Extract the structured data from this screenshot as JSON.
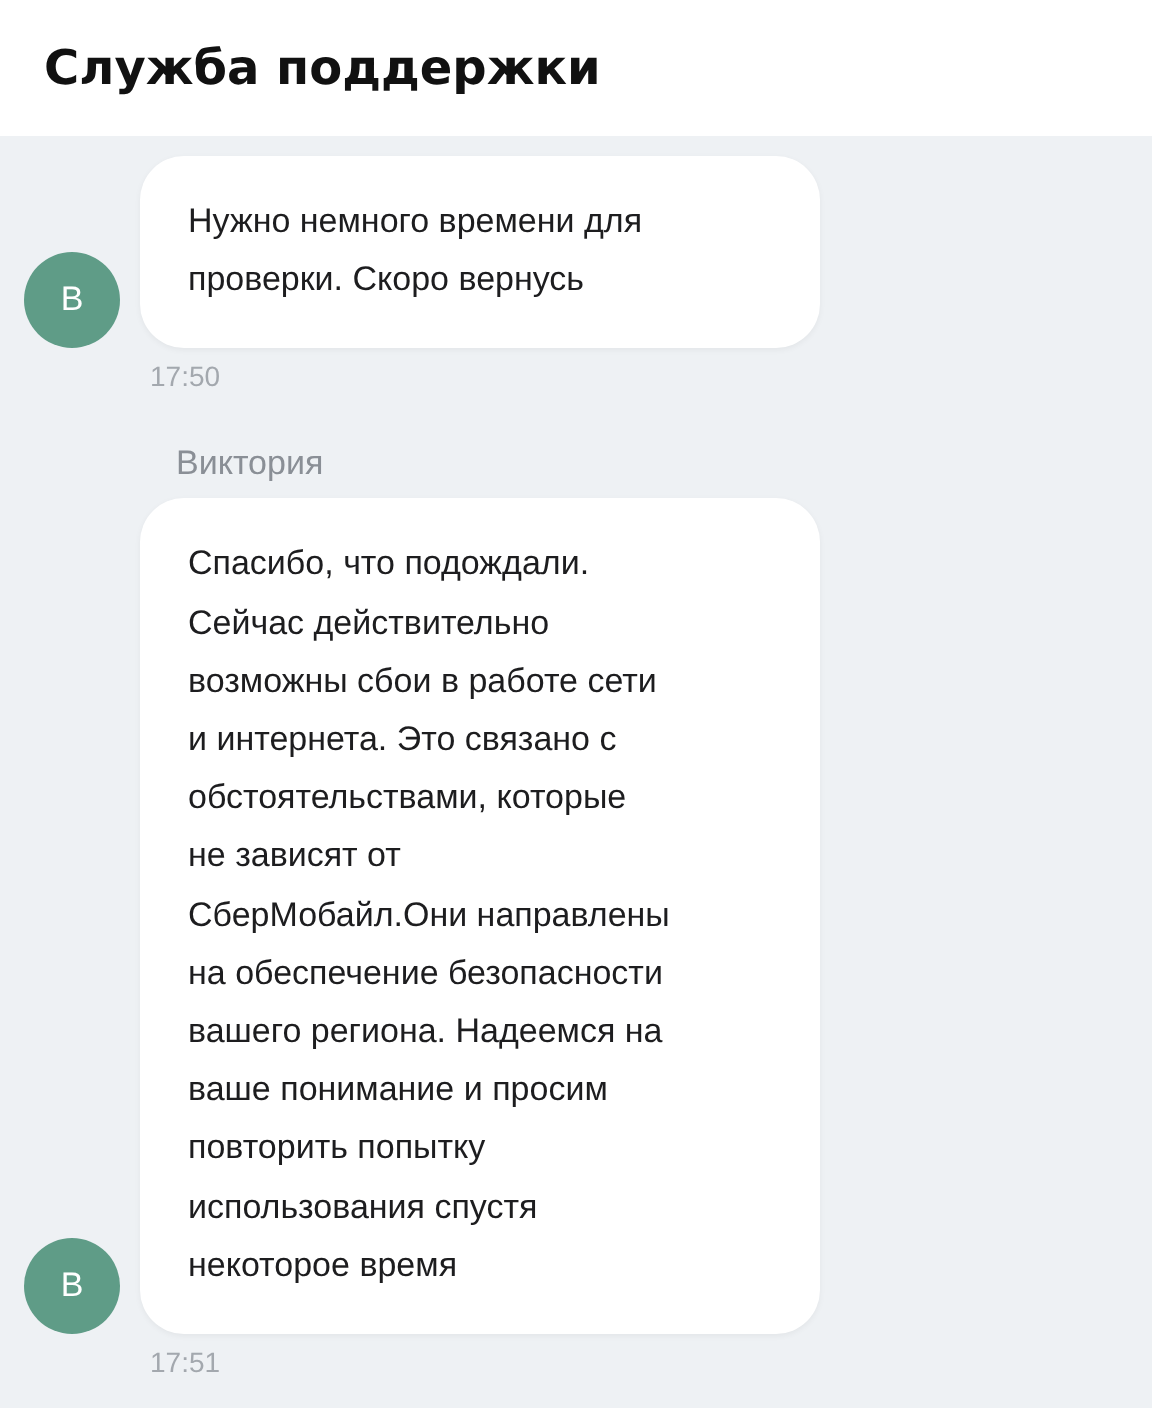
{
  "header": {
    "title": "Служба поддержки"
  },
  "messages": [
    {
      "avatar": "В",
      "lines": [
        "Нужно немного времени для",
        "проверки. Скоро вернусь"
      ],
      "time": "17:50"
    },
    {
      "sender": "Виктория",
      "avatar": "В",
      "lines": [
        "Спасибо, что подождали.",
        "Сейчас действительно",
        "возможны сбои в работе сети",
        "и интернета. Это связано с",
        "обстоятельствами, которые",
        "не зависят от",
        "СберМобайл.Они направлены",
        "на обеспечение безопасности",
        "вашего региона. Надеемся на",
        "ваше понимание и просим",
        "повторить попытку",
        "использования спустя",
        "некоторое время"
      ],
      "time": "17:51"
    }
  ]
}
